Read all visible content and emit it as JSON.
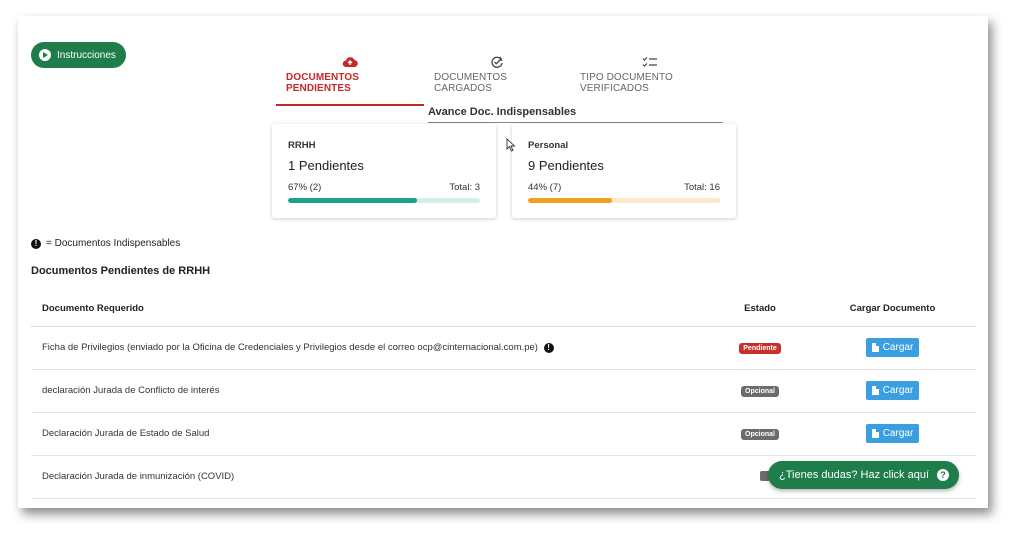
{
  "instructions_button": {
    "label": "Instrucciones",
    "icon": "play-circle-icon"
  },
  "tabs": [
    {
      "label": "DOCUMENTOS PENDIENTES",
      "icon": "cloud-upload-icon",
      "active": true
    },
    {
      "label": "DOCUMENTOS CARGADOS",
      "icon": "refresh-check-icon",
      "active": false
    },
    {
      "label": "TIPO DOCUMENTO VERIFICADOS",
      "icon": "checklist-icon",
      "active": false
    }
  ],
  "avance": {
    "title": "Avance Doc. Indispensables",
    "cards": [
      {
        "category": "RRHH",
        "pending": "1 Pendientes",
        "percent_text": "67% (2)",
        "total_text": "Total: 3",
        "progress": 0.67,
        "color": "#1aa38a",
        "track": "#d4efe9"
      },
      {
        "category": "Personal",
        "pending": "9 Pendientes",
        "percent_text": "44% (7)",
        "total_text": "Total: 16",
        "progress": 0.44,
        "color": "#f0a020",
        "track": "#fbe8c8"
      }
    ]
  },
  "legend": {
    "symbol": "!",
    "text": "= Documentos Indispensables"
  },
  "section_title": "Documentos Pendientes de RRHH",
  "table": {
    "headers": {
      "doc": "Documento Requerido",
      "estado": "Estado",
      "cargar": "Cargar Documento"
    },
    "rows": [
      {
        "doc": "Ficha de Privilegios (enviado por la Oficina de Credenciales y Privilegios desde el correo ocp@cinternacional.com.pe)",
        "indispensable": true,
        "estado": "Pendiente",
        "estado_type": "pendiente",
        "button": "Cargar"
      },
      {
        "doc": "declaración Jurada de Conflicto de interés",
        "indispensable": false,
        "estado": "Opcional",
        "estado_type": "opcional",
        "button": "Cargar"
      },
      {
        "doc": "Declaración Jurada de Estado de Salud",
        "indispensable": false,
        "estado": "Opcional",
        "estado_type": "opcional",
        "button": "Cargar"
      },
      {
        "doc": "Declaración Jurada de inmunización (COVID)",
        "indispensable": false,
        "estado": "",
        "estado_type": "opcional",
        "button": ""
      }
    ]
  },
  "help_button": {
    "label": "¿Tienes dudas? Haz click aquí",
    "icon": "question-circle-icon"
  },
  "colors": {
    "accent_green": "#1e7d4a",
    "active_tab": "#c62828",
    "button_blue": "#3a9ee0"
  }
}
